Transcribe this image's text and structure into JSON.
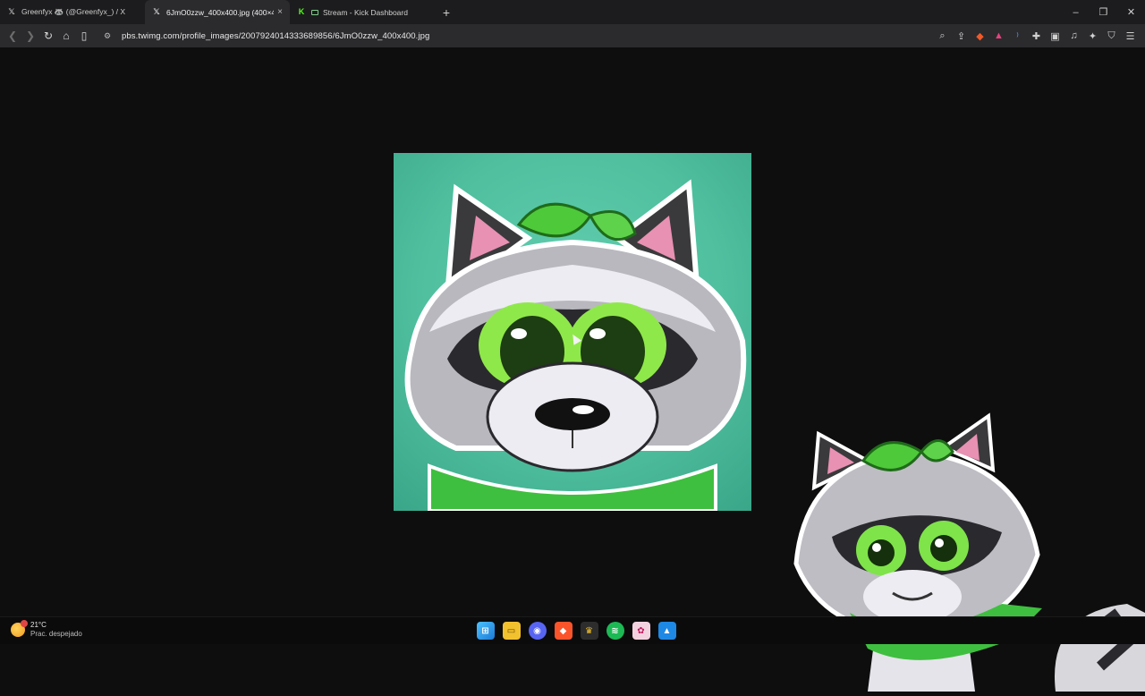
{
  "tabs": [
    {
      "icon": "x-logo-icon",
      "label": "Greenfyx 🦝 (@Greenfyx_) / X",
      "active": false
    },
    {
      "icon": "x-logo-icon",
      "label": "6JmO0zzw_400x400.jpg (400×40",
      "active": true,
      "close": "×"
    },
    {
      "icon": "kick-logo-icon",
      "label": "Stream - Kick Dashboard",
      "active": false
    }
  ],
  "new_tab": "+",
  "window_controls": {
    "minimize": "–",
    "restore": "❐",
    "close": "✕"
  },
  "address_bar": {
    "url": "pbs.twimg.com/profile_images/2007924014333689856/6JmO0zzw_400x400.jpg"
  },
  "toolbar_icons": [
    "back-icon",
    "forward-icon",
    "reload-icon",
    "home-icon",
    "bookmark-icon",
    "zoom-icon",
    "share-icon",
    "brave-shields-icon",
    "brave-rewards-icon",
    "wallet-icon",
    "extensions-icon",
    "sidebar-icon",
    "media-icon",
    "leo-icon",
    "vpn-icon",
    "menu-icon"
  ],
  "image": {
    "name": "6JmO0zzw_400x400.jpg",
    "width": 400,
    "height": 400
  },
  "taskbar": {
    "weather_temp": "21°C",
    "weather_condition": "Prac. despejado",
    "apps": [
      "windows-start-icon",
      "file-explorer-icon",
      "discord-icon",
      "brave-icon",
      "app-icon",
      "spotify-icon",
      "app-pink-icon",
      "app-blue-icon"
    ]
  },
  "colors": {
    "accent_green": "#3fbf3f",
    "image_bg": "#4fbf9e",
    "tab_active": "#2b2b2e"
  }
}
